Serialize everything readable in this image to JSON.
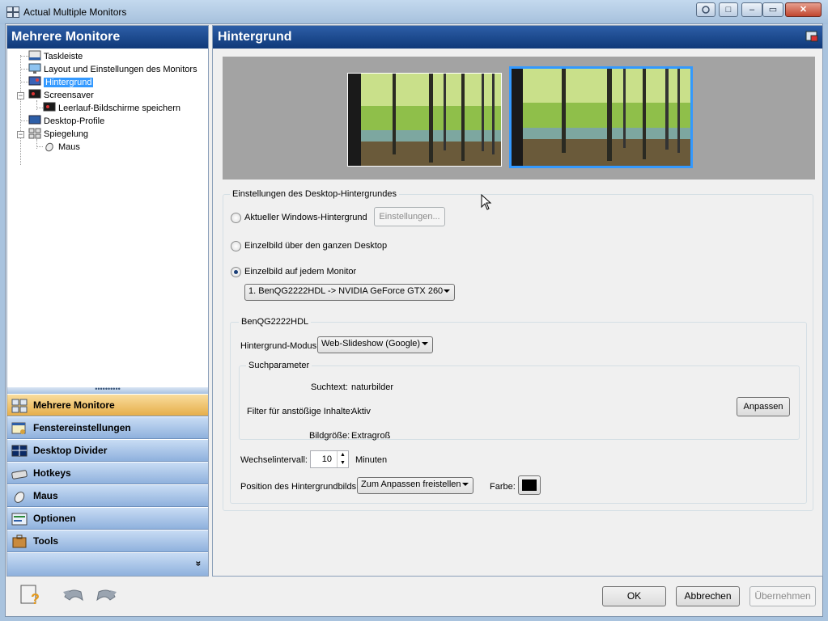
{
  "window": {
    "title": "Actual Multiple Monitors",
    "btn_restore": "□",
    "btn_min": "–",
    "btn_max": "▭",
    "btn_close": "✕"
  },
  "sidebar": {
    "header": "Mehrere Monitore",
    "tree": [
      {
        "label": "Taskleiste"
      },
      {
        "label": "Layout und Einstellungen des Monitors"
      },
      {
        "label": "Hintergrund",
        "selected": true
      },
      {
        "label": "Screensaver"
      },
      {
        "label": "Leerlauf-Bildschirme speichern"
      },
      {
        "label": "Desktop-Profile"
      },
      {
        "label": "Spiegelung"
      },
      {
        "label": "Maus"
      }
    ],
    "splitter": "••••••••••",
    "nav": [
      {
        "label": "Mehrere Monitore",
        "active": true
      },
      {
        "label": "Fenstereinstellungen"
      },
      {
        "label": "Desktop Divider"
      },
      {
        "label": "Hotkeys"
      },
      {
        "label": "Maus"
      },
      {
        "label": "Optionen"
      },
      {
        "label": "Tools"
      }
    ],
    "more": "»"
  },
  "main": {
    "header": "Hintergrund",
    "group_title": "Einstellungen des Desktop-Hintergrundes",
    "radio_windows": "Aktueller Windows-Hintergrund",
    "btn_einstellungen": "Einstellungen...",
    "radio_single": "Einzelbild über den ganzen Desktop",
    "radio_each": "Einzelbild auf jedem Monitor",
    "monitor_select": "1. BenQG2222HDL -> NVIDIA GeForce GTX 260",
    "monitor_group": "BenQG2222HDL",
    "mode_label": "Hintergrund-Modus",
    "mode_value": "Web-Slideshow (Google)",
    "search_group": "Suchparameter",
    "search_text_label": "Suchtext:",
    "search_text_value": "naturbilder",
    "filter_label": "Filter für anstößige Inhalte:",
    "filter_value": "Aktiv",
    "size_label": "Bildgröße:",
    "size_value": "Extragroß",
    "btn_anpassen": "Anpassen",
    "interval_label": "Wechselintervall:",
    "interval_value": "10",
    "interval_unit": "Minuten",
    "position_label": "Position des Hintergrundbilds:",
    "position_value": "Zum Anpassen freistellen",
    "color_label": "Farbe:"
  },
  "footer": {
    "ok": "OK",
    "cancel": "Abbrechen",
    "apply": "Übernehmen"
  },
  "colors": {
    "header_blue": "#0f3979",
    "selected_monitor": "#3399ff",
    "nav_active": "#e6ae4a",
    "bg_color_swatch": "#000000"
  }
}
